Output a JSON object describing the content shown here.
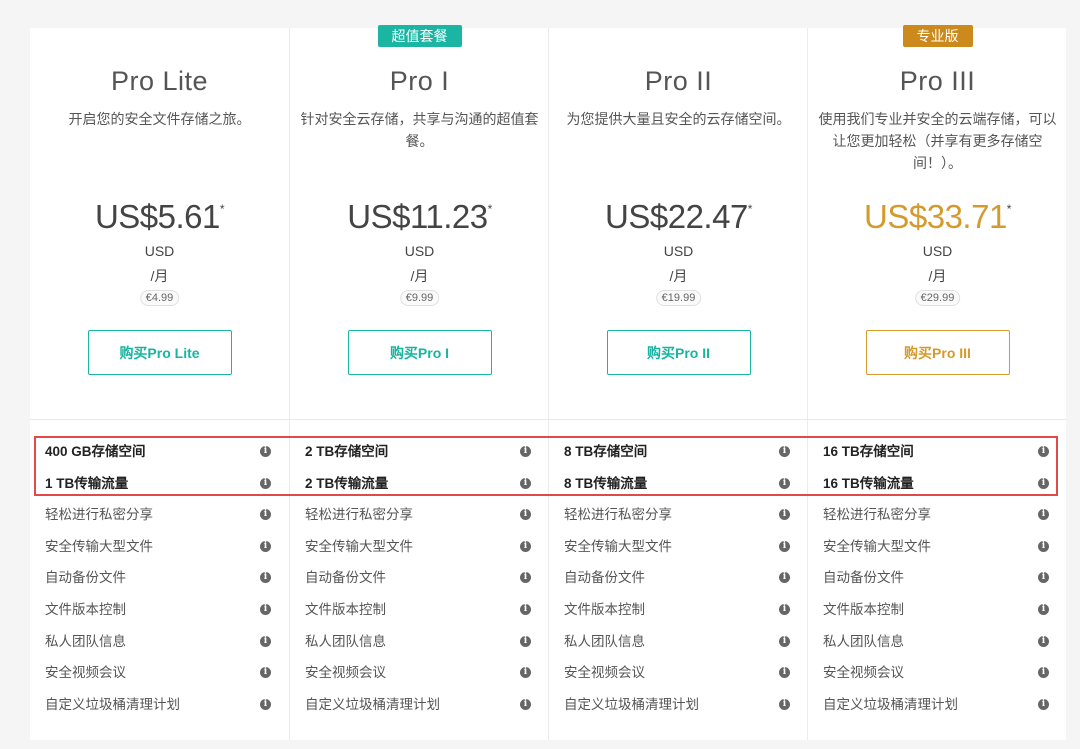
{
  "plans": [
    {
      "name": "Pro Lite",
      "badge": "",
      "description": "开启您的安全文件存储之旅。",
      "price": "US$5.61",
      "price_mark": "*",
      "currency": "USD",
      "period": "/月",
      "eur": "€4.99",
      "button": "购买Pro Lite",
      "features": [
        "400 GB存储空间",
        "1 TB传输流量",
        "轻松进行私密分享",
        "安全传输大型文件",
        "自动备份文件",
        "文件版本控制",
        "私人团队信息",
        "安全视频会议",
        "自定义垃圾桶清理计划"
      ]
    },
    {
      "name": "Pro I",
      "badge": "超值套餐",
      "description": "针对安全云存储，共享与沟通的超值套餐。",
      "price": "US$11.23",
      "price_mark": "*",
      "currency": "USD",
      "period": "/月",
      "eur": "€9.99",
      "button": "购买Pro I",
      "features": [
        "2 TB存储空间",
        "2 TB传输流量",
        "轻松进行私密分享",
        "安全传输大型文件",
        "自动备份文件",
        "文件版本控制",
        "私人团队信息",
        "安全视频会议",
        "自定义垃圾桶清理计划"
      ]
    },
    {
      "name": "Pro II",
      "badge": "",
      "description": "为您提供大量且安全的云存储空间。",
      "price": "US$22.47",
      "price_mark": "*",
      "currency": "USD",
      "period": "/月",
      "eur": "€19.99",
      "button": "购买Pro II",
      "features": [
        "8 TB存储空间",
        "8 TB传输流量",
        "轻松进行私密分享",
        "安全传输大型文件",
        "自动备份文件",
        "文件版本控制",
        "私人团队信息",
        "安全视频会议",
        "自定义垃圾桶清理计划"
      ]
    },
    {
      "name": "Pro III",
      "badge": "专业版",
      "description": "使用我们专业并安全的云端存储，可以让您更加轻松（并享有更多存储空间！）。",
      "price": "US$33.71",
      "price_mark": "*",
      "currency": "USD",
      "period": "/月",
      "eur": "€29.99",
      "button": "购买Pro III",
      "features": [
        "16 TB存储空间",
        "16 TB传输流量",
        "轻松进行私密分享",
        "安全传输大型文件",
        "自动备份文件",
        "文件版本控制",
        "私人团队信息",
        "安全视频会议",
        "自定义垃圾桶清理计划"
      ]
    }
  ],
  "info_glyph": "i",
  "colors": {
    "teal": "#1ab6a3",
    "gold": "#d49a2c",
    "highlight": "#e24a4a"
  }
}
